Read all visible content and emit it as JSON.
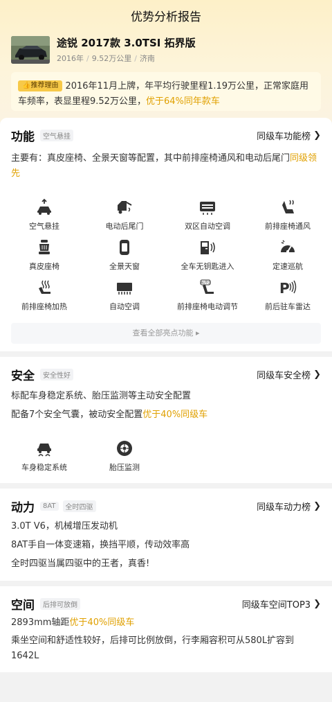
{
  "header": {
    "title": "优势分析报告"
  },
  "car": {
    "name": "途锐 2017款 3.0TSI 拓界版",
    "year": "2016年",
    "mileage": "9.52万公里",
    "city": "济南",
    "separator": "/"
  },
  "reason": {
    "badge": "推荐理由",
    "text": "2016年11月上牌，年平均行驶里程1.19万公里，正常家庭用车频率，表显里程9.52万公里，",
    "highlight": "优于64%同年款车"
  },
  "features": {
    "title": "功能",
    "tag": "空气悬挂",
    "rank": "同级车功能榜",
    "summary": "主要有：真皮座椅、全景天窗等配置，其中前排座椅通风和电动后尾门",
    "summary_hl": "同级领先",
    "items": [
      {
        "label": "空气悬挂",
        "icon": "air-suspension-icon"
      },
      {
        "label": "电动后尾门",
        "icon": "power-tailgate-icon"
      },
      {
        "label": "双区自动空调",
        "icon": "dual-zone-ac-icon"
      },
      {
        "label": "前排座椅通风",
        "icon": "seat-ventilation-icon"
      },
      {
        "label": "真皮座椅",
        "icon": "leather-seat-icon"
      },
      {
        "label": "全景天窗",
        "icon": "panoramic-sunroof-icon"
      },
      {
        "label": "全车无钥匙进入",
        "icon": "keyless-entry-icon"
      },
      {
        "label": "定速巡航",
        "icon": "cruise-control-icon"
      },
      {
        "label": "前排座椅加热",
        "icon": "seat-heating-icon"
      },
      {
        "label": "自动空调",
        "icon": "auto-ac-icon"
      },
      {
        "label": "前排座椅电动调节",
        "icon": "power-seat-icon"
      },
      {
        "label": "前后驻车雷达",
        "icon": "parking-radar-icon"
      }
    ],
    "view_all": "查看全部亮点功能 ▸"
  },
  "safety": {
    "title": "安全",
    "tag": "安全性好",
    "rank": "同级车安全榜",
    "line1": "标配车身稳定系统、胎压监测等主动安全配置",
    "line2": "配备7个安全气囊，被动安全配置",
    "line2_hl": "优于40%同级车",
    "items": [
      {
        "label": "车身稳定系统",
        "icon": "stability-control-icon"
      },
      {
        "label": "胎压监测",
        "icon": "tire-pressure-icon"
      }
    ]
  },
  "power": {
    "title": "动力",
    "tag1": "8AT",
    "tag2": "全时四驱",
    "rank": "同级车动力榜",
    "line1": "3.0T V6，机械增压发动机",
    "line2": "8AT手自一体变速箱，换挡平顺，传动效率高",
    "line3": "全时四驱当属四驱中的王者，真香!"
  },
  "space": {
    "title": "空间",
    "tag": "后排可放倒",
    "rank": "同级车空间TOP3",
    "line1": "2893mm轴距",
    "line1_hl": "优于40%同级车",
    "line2": "乘坐空间和舒适性较好，后排可比例放倒，行李厢容积可从580L扩容到1642L"
  },
  "colors": {
    "accent": "#e0a000",
    "badge": "#f7c948"
  }
}
